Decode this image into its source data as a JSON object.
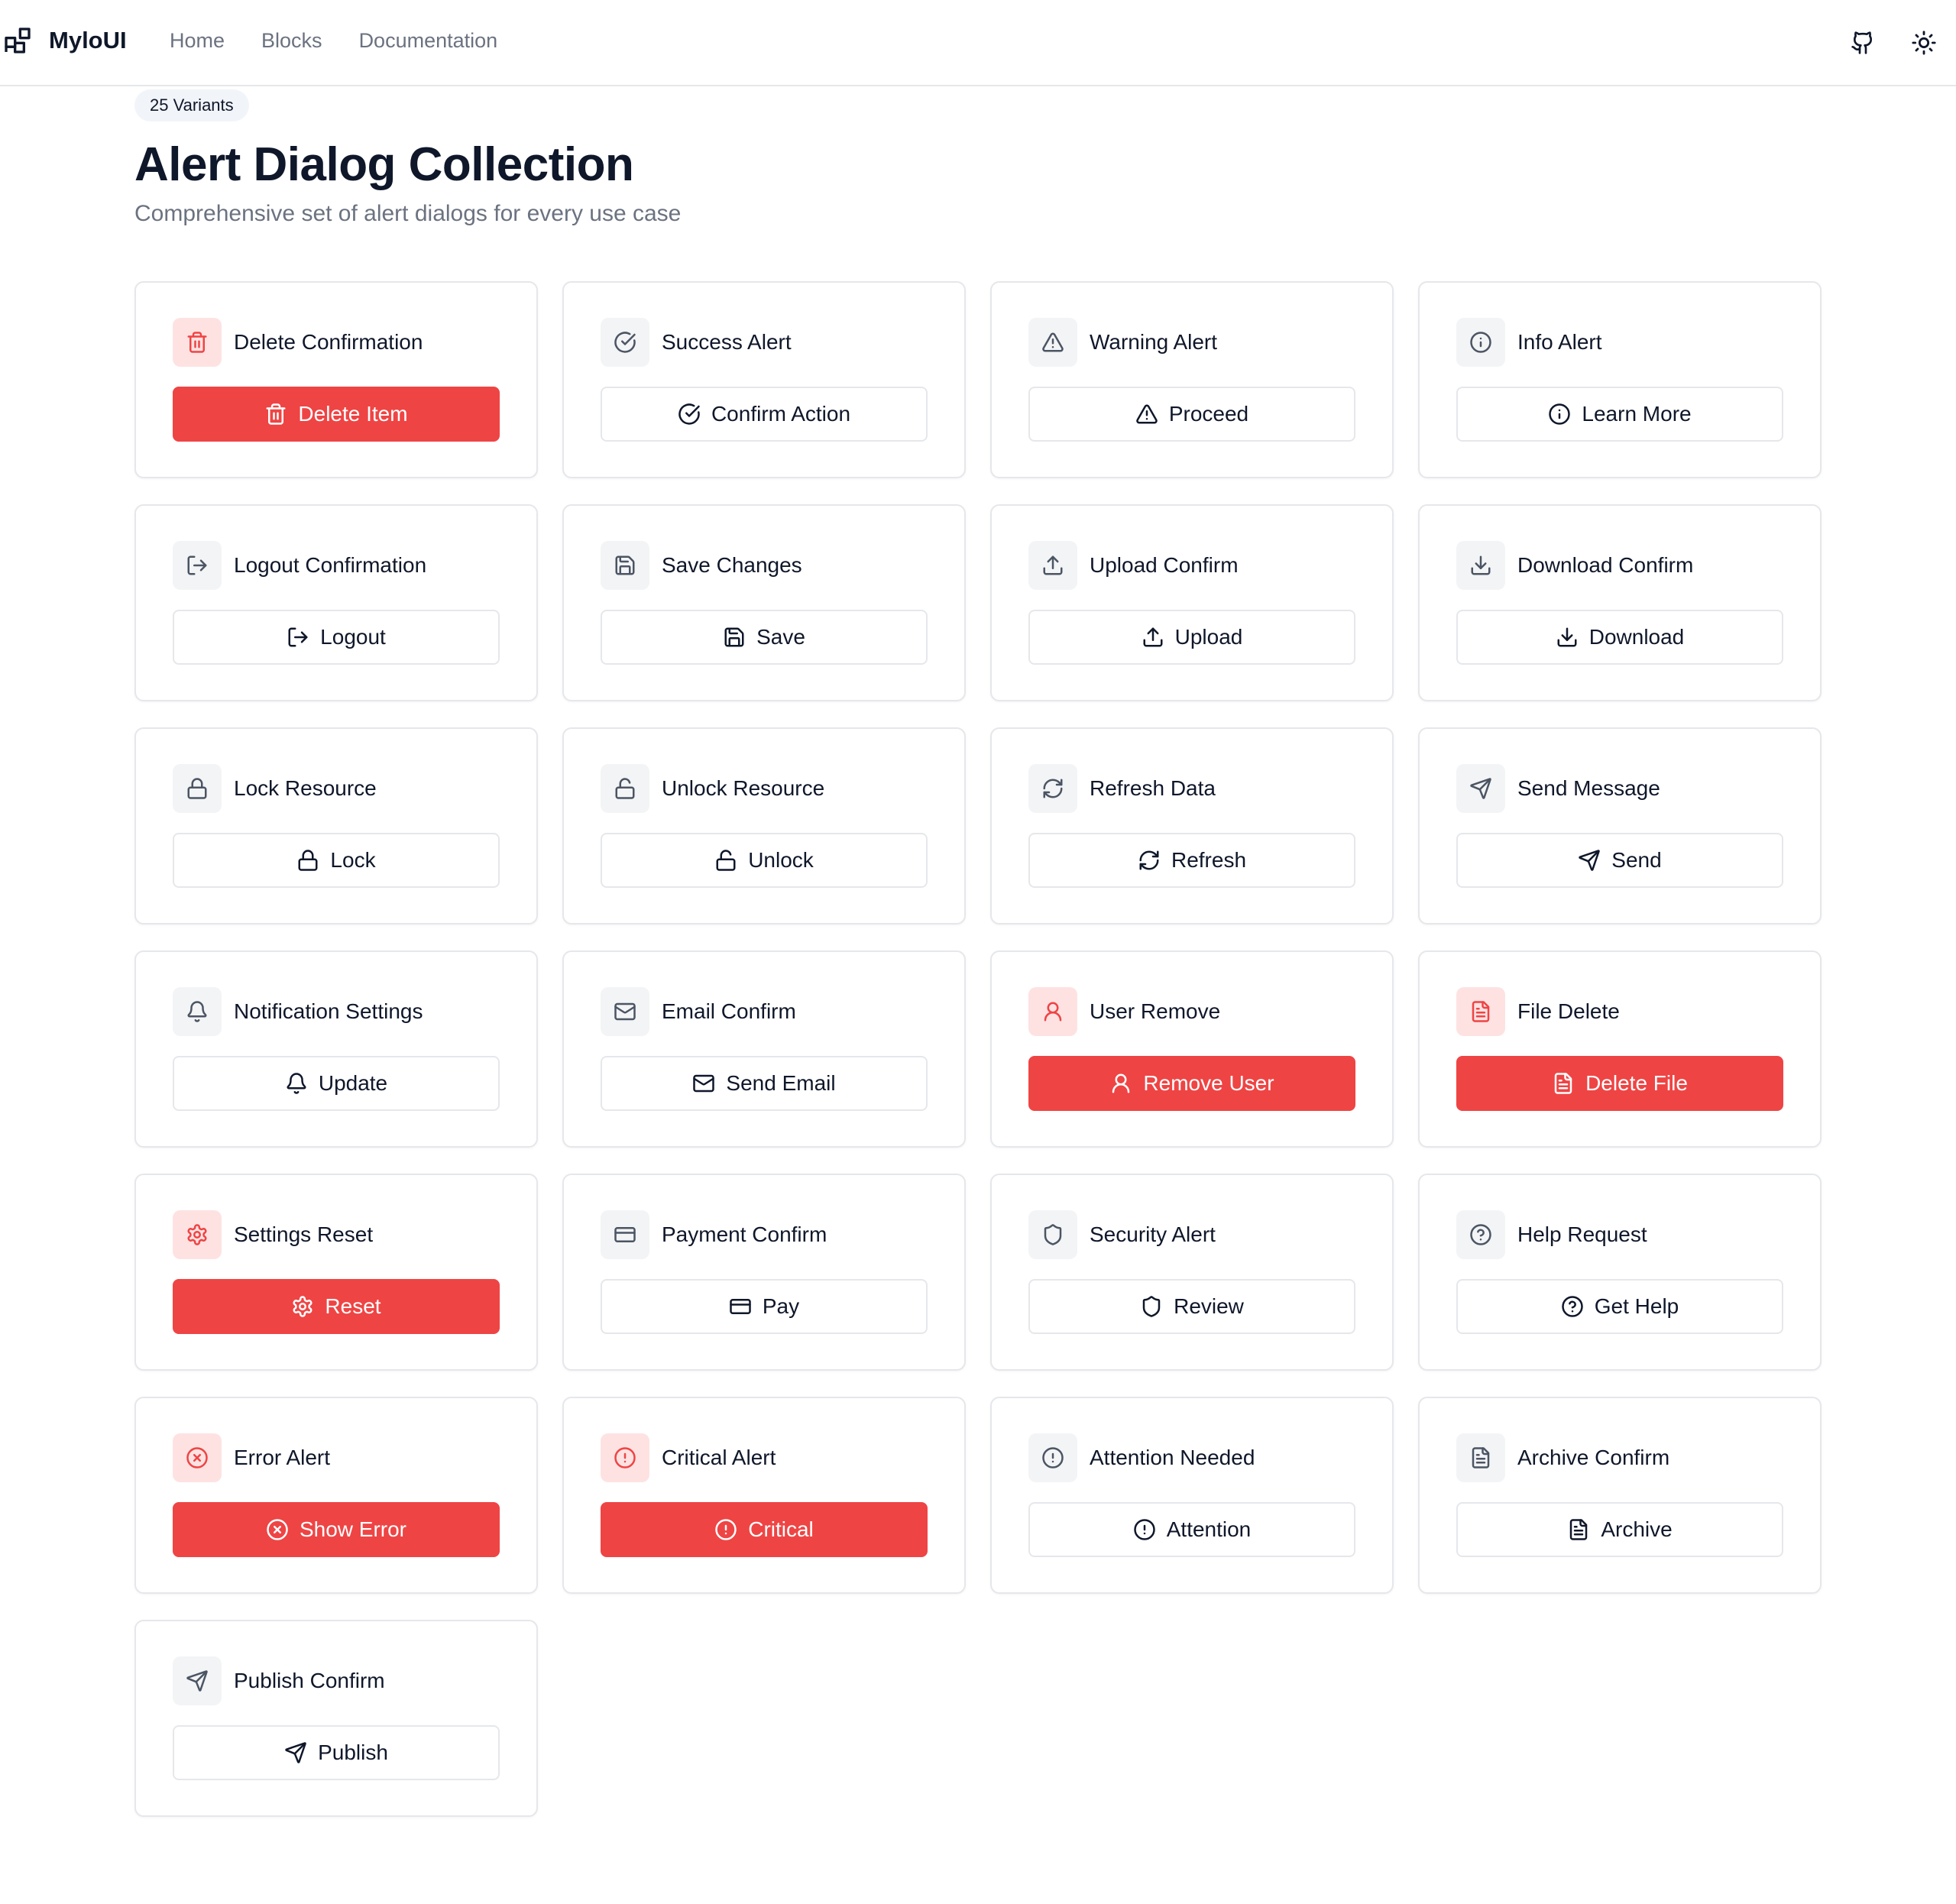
{
  "header": {
    "brand": "MyloUI",
    "nav": [
      "Home",
      "Blocks",
      "Documentation"
    ]
  },
  "intro": {
    "badge": "25 Variants",
    "title": "Alert Dialog Collection",
    "subtitle": "Comprehensive set of alert dialogs for every use case"
  },
  "colors": {
    "danger": "#ef4444",
    "danger_soft": "#fee2e2",
    "neutral_soft": "#f3f4f6",
    "text": "#0f172a",
    "muted": "#6b7280"
  },
  "cards": [
    {
      "title": "Delete Confirmation",
      "button": "Delete Item",
      "icon": "trash-icon",
      "variant": "danger"
    },
    {
      "title": "Success Alert",
      "button": "Confirm Action",
      "icon": "check-circle-icon",
      "variant": "outline"
    },
    {
      "title": "Warning Alert",
      "button": "Proceed",
      "icon": "warning-triangle-icon",
      "variant": "outline"
    },
    {
      "title": "Info Alert",
      "button": "Learn More",
      "icon": "info-icon",
      "variant": "outline"
    },
    {
      "title": "Logout Confirmation",
      "button": "Logout",
      "icon": "logout-icon",
      "variant": "outline"
    },
    {
      "title": "Save Changes",
      "button": "Save",
      "icon": "save-icon",
      "variant": "outline"
    },
    {
      "title": "Upload Confirm",
      "button": "Upload",
      "icon": "upload-icon",
      "variant": "outline"
    },
    {
      "title": "Download Confirm",
      "button": "Download",
      "icon": "download-icon",
      "variant": "outline"
    },
    {
      "title": "Lock Resource",
      "button": "Lock",
      "icon": "lock-icon",
      "variant": "outline"
    },
    {
      "title": "Unlock Resource",
      "button": "Unlock",
      "icon": "unlock-icon",
      "variant": "outline"
    },
    {
      "title": "Refresh Data",
      "button": "Refresh",
      "icon": "refresh-icon",
      "variant": "outline"
    },
    {
      "title": "Send Message",
      "button": "Send",
      "icon": "send-icon",
      "variant": "outline"
    },
    {
      "title": "Notification Settings",
      "button": "Update",
      "icon": "bell-icon",
      "variant": "outline"
    },
    {
      "title": "Email Confirm",
      "button": "Send Email",
      "icon": "mail-icon",
      "variant": "outline"
    },
    {
      "title": "User Remove",
      "button": "Remove User",
      "icon": "user-icon",
      "variant": "danger"
    },
    {
      "title": "File Delete",
      "button": "Delete File",
      "icon": "file-text-icon",
      "variant": "danger"
    },
    {
      "title": "Settings Reset",
      "button": "Reset",
      "icon": "gear-icon",
      "variant": "danger"
    },
    {
      "title": "Payment Confirm",
      "button": "Pay",
      "icon": "credit-card-icon",
      "variant": "outline"
    },
    {
      "title": "Security Alert",
      "button": "Review",
      "icon": "shield-icon",
      "variant": "outline"
    },
    {
      "title": "Help Request",
      "button": "Get Help",
      "icon": "help-circle-icon",
      "variant": "outline"
    },
    {
      "title": "Error Alert",
      "button": "Show Error",
      "icon": "x-circle-icon",
      "variant": "danger"
    },
    {
      "title": "Critical Alert",
      "button": "Critical",
      "icon": "alert-circle-icon",
      "variant": "danger"
    },
    {
      "title": "Attention Needed",
      "button": "Attention",
      "icon": "alert-circle-icon",
      "variant": "outline"
    },
    {
      "title": "Archive Confirm",
      "button": "Archive",
      "icon": "file-text-icon",
      "variant": "outline"
    },
    {
      "title": "Publish Confirm",
      "button": "Publish",
      "icon": "send-icon",
      "variant": "outline"
    }
  ]
}
